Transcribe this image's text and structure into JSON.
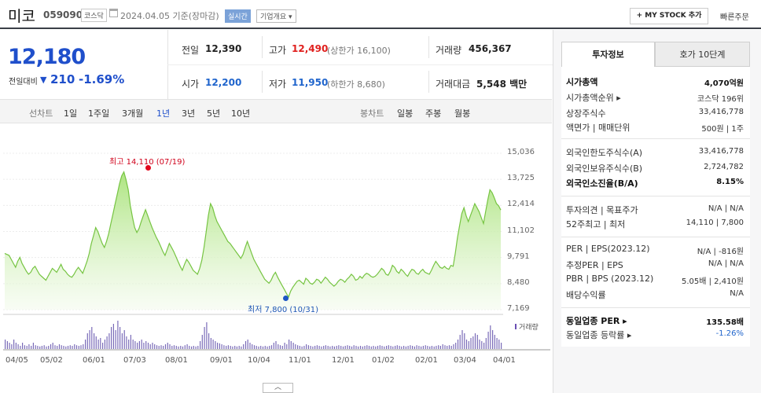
{
  "header": {
    "name": "미코",
    "code": "059090",
    "market": "코스닥",
    "date": "2024.04.05",
    "basis": "기준(장마감)",
    "realtime": "실시간",
    "overview": "기업개요 ▾",
    "my_stock": "+ MY STOCK 추가",
    "quick_order": "빠른주문"
  },
  "price": {
    "current": "12,180",
    "change_label": "전일대비",
    "change_arrow": "▼",
    "change": "210",
    "change_pct": "-1.69%"
  },
  "quote": {
    "prev_close_label": "전일",
    "prev_close": "12,390",
    "high_label": "고가",
    "high": "12,490",
    "upper_limit": "(상한가 16,100)",
    "volume_label": "거래량",
    "volume": "456,367",
    "open_label": "시가",
    "open": "12,200",
    "low_label": "저가",
    "low": "11,950",
    "lower_limit": "(하한가 8,680)",
    "amount_label": "거래대금",
    "amount": "5,548 백만"
  },
  "periods": {
    "line_label": "선차트",
    "line": [
      "1일",
      "1주일",
      "3개월",
      "1년",
      "3년",
      "5년",
      "10년"
    ],
    "candle_label": "봉차트",
    "candle": [
      "일봉",
      "주봉",
      "월봉"
    ]
  },
  "chart_data": {
    "type": "area",
    "y_ticks": [
      "15,036",
      "13,725",
      "12,414",
      "11,102",
      "9,791",
      "8,480",
      "7,169"
    ],
    "x_ticks": [
      "04/05",
      "05/02",
      "06/01",
      "07/03",
      "08/01",
      "09/01",
      "10/04",
      "11/01",
      "12/01",
      "01/02",
      "02/01",
      "03/04",
      "04/01"
    ],
    "ylim": [
      7169,
      15036
    ],
    "high_label": "최고 14,110 (07/19)",
    "low_label": "최저 7,800 (10/31)",
    "volume_label": "거래량",
    "prices": [
      10000,
      9950,
      9900,
      9700,
      9500,
      9300,
      9600,
      9800,
      9500,
      9300,
      9100,
      8950,
      9050,
      9250,
      9350,
      9150,
      8950,
      8850,
      8750,
      8650,
      8850,
      9050,
      9250,
      9150,
      9050,
      9250,
      9450,
      9200,
      9100,
      8950,
      8850,
      8800,
      8950,
      9150,
      9300,
      9150,
      9000,
      9300,
      9600,
      10000,
      10500,
      10900,
      11300,
      11100,
      10800,
      10500,
      10300,
      10600,
      11000,
      11500,
      12000,
      12500,
      13000,
      13500,
      13900,
      14100,
      13700,
      13200,
      12400,
      11800,
      11300,
      11050,
      11250,
      11600,
      11900,
      12200,
      11900,
      11600,
      11300,
      11050,
      10800,
      10600,
      10350,
      10100,
      9900,
      10200,
      10500,
      10300,
      10100,
      9850,
      9600,
      9350,
      9150,
      9450,
      9700,
      9550,
      9350,
      9150,
      9050,
      8950,
      9250,
      9650,
      10300,
      11100,
      11900,
      12500,
      12300,
      11900,
      11600,
      11400,
      11200,
      11000,
      10800,
      10600,
      10500,
      10350,
      10200,
      10050,
      9900,
      9750,
      9950,
      10300,
      10600,
      10300,
      10000,
      9700,
      9500,
      9300,
      9100,
      8900,
      8700,
      8600,
      8500,
      8650,
      8900,
      9050,
      8800,
      8600,
      8400,
      8200,
      8000,
      7800,
      8100,
      8300,
      8450,
      8600,
      8650,
      8550,
      8450,
      8750,
      8650,
      8500,
      8450,
      8550,
      8700,
      8650,
      8500,
      8650,
      8800,
      8700,
      8550,
      8450,
      8350,
      8450,
      8600,
      8700,
      8650,
      8550,
      8700,
      8800,
      8950,
      8850,
      8650,
      8700,
      8850,
      8750,
      8900,
      9000,
      8950,
      8850,
      8800,
      8850,
      8950,
      9100,
      9250,
      9150,
      8950,
      8900,
      9100,
      9400,
      9300,
      9100,
      9000,
      9200,
      9100,
      8950,
      8850,
      9050,
      9200,
      9150,
      9000,
      8950,
      9100,
      9200,
      9050,
      9000,
      8950,
      9150,
      9400,
      9600,
      9450,
      9300,
      9250,
      9350,
      9250,
      9200,
      9400,
      9350,
      10000,
      10800,
      11400,
      12000,
      12300,
      11900,
      11600,
      11900,
      12200,
      12500,
      12300,
      12100,
      11800,
      11500,
      12100,
      12700,
      13200,
      13050,
      12800,
      12500,
      12400,
      12180
    ],
    "volumes": [
      0.3,
      0.25,
      0.2,
      0.15,
      0.3,
      0.2,
      0.15,
      0.1,
      0.2,
      0.12,
      0.1,
      0.15,
      0.1,
      0.2,
      0.12,
      0.1,
      0.08,
      0.1,
      0.12,
      0.08,
      0.1,
      0.15,
      0.2,
      0.12,
      0.1,
      0.15,
      0.12,
      0.1,
      0.08,
      0.1,
      0.12,
      0.1,
      0.15,
      0.12,
      0.1,
      0.12,
      0.15,
      0.3,
      0.5,
      0.6,
      0.7,
      0.5,
      0.4,
      0.3,
      0.35,
      0.2,
      0.3,
      0.4,
      0.5,
      0.7,
      0.8,
      0.6,
      0.9,
      0.7,
      0.5,
      0.6,
      0.4,
      0.3,
      0.45,
      0.3,
      0.25,
      0.2,
      0.25,
      0.3,
      0.2,
      0.25,
      0.2,
      0.15,
      0.2,
      0.15,
      0.12,
      0.1,
      0.12,
      0.1,
      0.15,
      0.2,
      0.15,
      0.1,
      0.12,
      0.1,
      0.08,
      0.1,
      0.08,
      0.12,
      0.15,
      0.1,
      0.08,
      0.1,
      0.08,
      0.1,
      0.25,
      0.45,
      0.7,
      0.85,
      0.5,
      0.35,
      0.3,
      0.25,
      0.2,
      0.18,
      0.15,
      0.12,
      0.1,
      0.12,
      0.1,
      0.08,
      0.1,
      0.08,
      0.1,
      0.08,
      0.15,
      0.25,
      0.3,
      0.2,
      0.15,
      0.12,
      0.1,
      0.08,
      0.1,
      0.08,
      0.1,
      0.08,
      0.1,
      0.12,
      0.2,
      0.25,
      0.15,
      0.12,
      0.1,
      0.2,
      0.15,
      0.3,
      0.25,
      0.2,
      0.15,
      0.12,
      0.1,
      0.08,
      0.1,
      0.15,
      0.12,
      0.1,
      0.08,
      0.1,
      0.12,
      0.1,
      0.08,
      0.1,
      0.12,
      0.1,
      0.08,
      0.1,
      0.08,
      0.1,
      0.12,
      0.1,
      0.08,
      0.1,
      0.12,
      0.1,
      0.08,
      0.12,
      0.1,
      0.08,
      0.1,
      0.08,
      0.1,
      0.12,
      0.1,
      0.08,
      0.1,
      0.08,
      0.1,
      0.12,
      0.1,
      0.08,
      0.1,
      0.12,
      0.1,
      0.08,
      0.1,
      0.12,
      0.1,
      0.08,
      0.1,
      0.08,
      0.1,
      0.12,
      0.1,
      0.08,
      0.12,
      0.1,
      0.08,
      0.1,
      0.12,
      0.1,
      0.08,
      0.1,
      0.08,
      0.1,
      0.12,
      0.1,
      0.15,
      0.12,
      0.1,
      0.12,
      0.1,
      0.15,
      0.2,
      0.3,
      0.45,
      0.6,
      0.5,
      0.3,
      0.25,
      0.35,
      0.4,
      0.5,
      0.45,
      0.3,
      0.25,
      0.2,
      0.35,
      0.55,
      0.75,
      0.6,
      0.45,
      0.35,
      0.3,
      0.2
    ]
  },
  "right_panel": {
    "tab_invest": "투자정보",
    "tab_hoga": "호가 10단계",
    "rows": [
      {
        "label": "시가총액",
        "value": "4,070억원"
      },
      {
        "label": "시가총액순위 ▸",
        "value": "코스닥 196위"
      },
      {
        "label": "상장주식수",
        "value": "33,416,778"
      },
      {
        "label": "액면가 | 매매단위",
        "value": "500원 | 1주"
      },
      {
        "label": "외국인한도주식수(A)",
        "value": "33,416,778"
      },
      {
        "label": "외국인보유주식수(B)",
        "value": "2,724,782"
      },
      {
        "label": "외국인소진율(B/A)",
        "value": "8.15%"
      },
      {
        "label": "투자의견 | 목표주가",
        "value": "N/A | N/A"
      },
      {
        "label": "52주최고 | 최저",
        "value": "14,110 | 7,800"
      },
      {
        "label": "PER | EPS(2023.12)",
        "value": "N/A | -816원"
      },
      {
        "label": "추정PER | EPS",
        "value": "N/A | N/A"
      },
      {
        "label": "PBR | BPS (2023.12)",
        "value": "5.05배 | 2,410원"
      },
      {
        "label": "배당수익률",
        "value": "N/A"
      },
      {
        "label": "동일업종 PER ▸",
        "value": "135.58배"
      },
      {
        "label": "동일업종 등락률 ▸",
        "value": "-1.26%"
      }
    ]
  },
  "colors": {
    "price_down": "#1f4fcb",
    "price_up": "#e0201e",
    "area_line": "#76c442",
    "area_fill_top": "#b7e88f",
    "volume_bar": "#7a6bb8"
  }
}
